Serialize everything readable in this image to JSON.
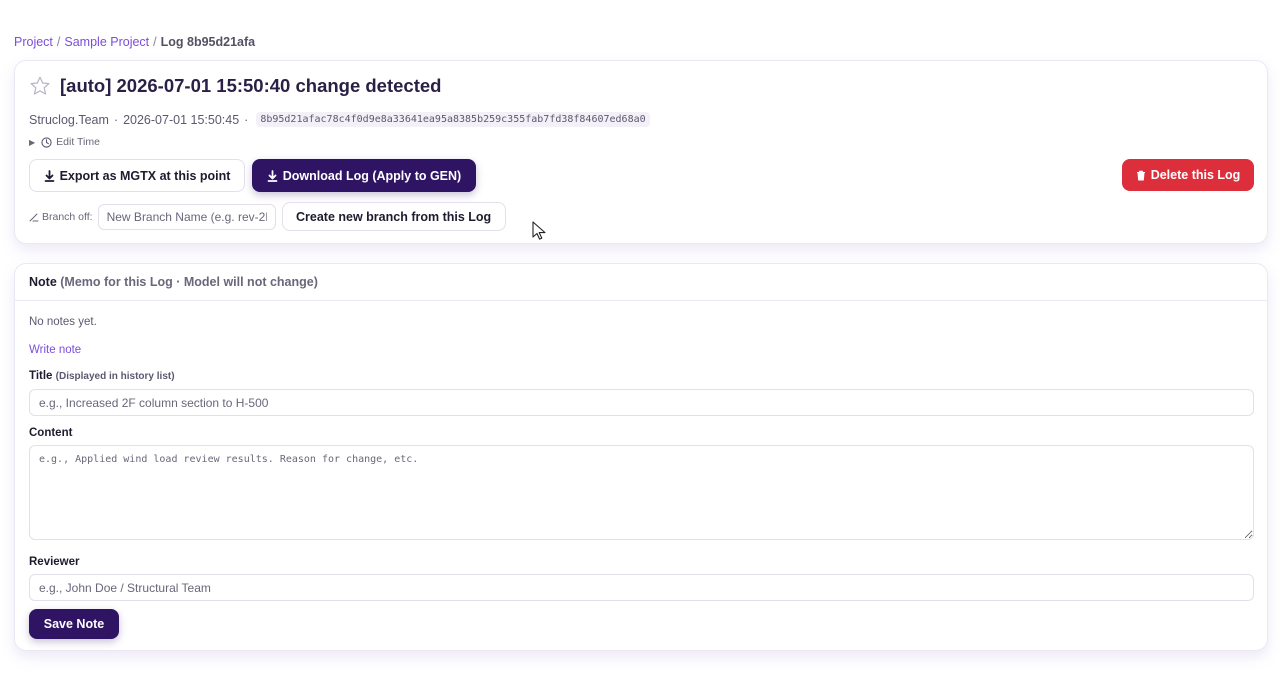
{
  "breadcrumb": {
    "items": [
      "Project",
      "Sample Project"
    ],
    "separator": "/",
    "current": "Log 8b95d21afa"
  },
  "log": {
    "title": "[auto] 2026-07-01 15:50:40 change detected",
    "author": "Struclog.Team",
    "timestamp": "2026-07-01 15:50:45",
    "meta_separator": "·",
    "hash": "8b95d21afac78c4f0d9e8a33641ea95a8385b259c355fab7fd38f84607ed68a0",
    "edit_time_label": "Edit Time"
  },
  "actions": {
    "export_label": "Export as MGTX at this point",
    "download_label": "Download Log (Apply to GEN)",
    "delete_label": "Delete this Log"
  },
  "branch": {
    "label": "Branch off:",
    "input_placeholder": "New Branch Name (e.g. rev-2F",
    "create_label": "Create new branch from this Log"
  },
  "note": {
    "header": "Note",
    "header_sub": "(Memo for this Log · Model will not change)",
    "empty_text": "No notes yet.",
    "write_link": "Write note",
    "title_label": "Title",
    "title_hint": "(Displayed in history list)",
    "title_placeholder": "e.g., Increased 2F column section to H-500",
    "content_label": "Content",
    "content_placeholder": "e.g., Applied wind load review results. Reason for change, etc.",
    "reviewer_label": "Reviewer",
    "reviewer_placeholder": "e.g., John Doe / Structural Team",
    "save_label": "Save Note"
  },
  "colors": {
    "primary": "#2e1462",
    "danger": "#dc2f3b",
    "link": "#7c4ddb"
  }
}
